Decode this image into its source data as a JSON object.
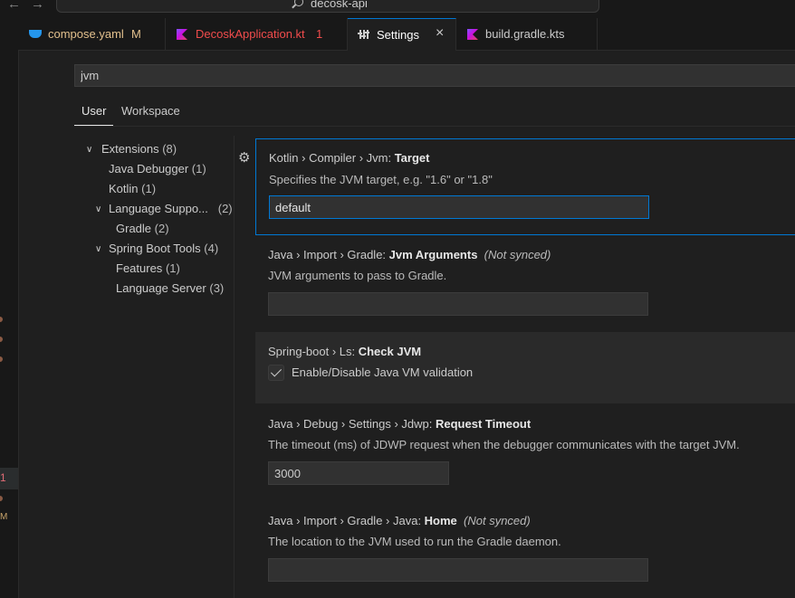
{
  "window": {
    "title": "decosk-api"
  },
  "tabs": [
    {
      "label": "compose.yaml",
      "mark": "M",
      "label_color": "#e2c08d"
    },
    {
      "label": "DecoskApplication.kt",
      "mark": "1",
      "label_color": "#f14c4c"
    },
    {
      "label": "Settings",
      "close": "×",
      "label_color": "#ffffff"
    },
    {
      "label": "build.gradle.kts",
      "label_color": "#cccccc"
    }
  ],
  "search": {
    "value": "jvm"
  },
  "scopes": {
    "user": "User",
    "workspace": "Workspace"
  },
  "activity_marks": {
    "selected": "1",
    "modified": "M"
  },
  "toc": [
    {
      "label": "Extensions",
      "count": "(8)"
    },
    {
      "label": "Java Debugger",
      "count": "(1)"
    },
    {
      "label": "Kotlin",
      "count": "(1)"
    },
    {
      "label": "Language Suppo...",
      "count": "(2)"
    },
    {
      "label": "Gradle",
      "count": "(2)"
    },
    {
      "label": "Spring Boot Tools",
      "count": "(4)"
    },
    {
      "label": "Features",
      "count": "(1)"
    },
    {
      "label": "Language Server",
      "count": "(3)"
    }
  ],
  "settings": [
    {
      "prefix": "Kotlin › Compiler › Jvm: ",
      "name": "Target",
      "description": "Specifies the JVM target, e.g. \"1.6\" or \"1.8\"",
      "value": "default"
    },
    {
      "prefix": "Java › Import › Gradle: ",
      "name": "Jvm Arguments",
      "note": "(Not synced)",
      "description": "JVM arguments to pass to Gradle.",
      "value": ""
    },
    {
      "prefix": "Spring-boot › Ls: ",
      "name": "Check JVM",
      "checkbox_label": "Enable/Disable Java VM validation",
      "checked": true
    },
    {
      "prefix": "Java › Debug › Settings › Jdwp: ",
      "name": "Request Timeout",
      "description": "The timeout (ms) of JDWP request when the debugger communicates with the target JVM.",
      "value": "3000"
    },
    {
      "prefix": "Java › Import › Gradle › Java: ",
      "name": "Home",
      "note": "(Not synced)",
      "description": "The location to the JVM used to run the Gradle daemon.",
      "value": ""
    }
  ]
}
